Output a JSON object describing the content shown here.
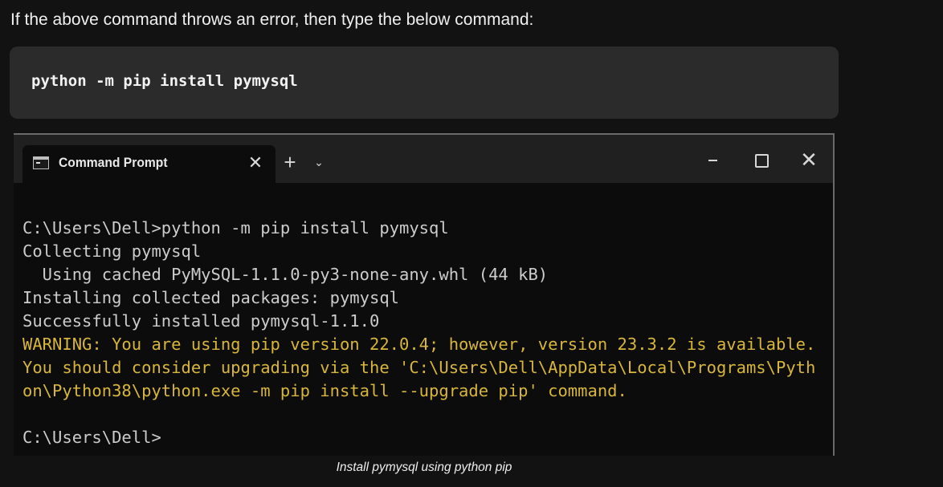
{
  "intro_text": "If the above command throws an error, then type the below command:",
  "code_block": {
    "command": "python -m pip install pymysql"
  },
  "window": {
    "tab_title": "Command Prompt",
    "tab_icon": "cmd-terminal-icon",
    "close_tab_symbol": "✕",
    "new_tab_symbol": "+",
    "dropdown_symbol": "⌄",
    "close_window_symbol": "✕"
  },
  "terminal": {
    "lines": [
      "C:\\Users\\Dell>python -m pip install pymysql",
      "Collecting pymysql",
      "  Using cached PyMySQL-1.1.0-py3-none-any.whl (44 kB)",
      "Installing collected packages: pymysql",
      "Successfully installed pymysql-1.1.0",
      "WARNING: You are using pip version 22.0.4; however, version 23.3.2 is available.",
      "You should consider upgrading via the 'C:\\Users\\Dell\\AppData\\Local\\Programs\\Pyth",
      "on\\Python38\\python.exe -m pip install --upgrade pip' command.",
      "",
      "C:\\Users\\Dell>"
    ],
    "warning_color": "#d7b63b",
    "text_color": "#cccccc"
  },
  "caption": "Install pymysql using python pip"
}
